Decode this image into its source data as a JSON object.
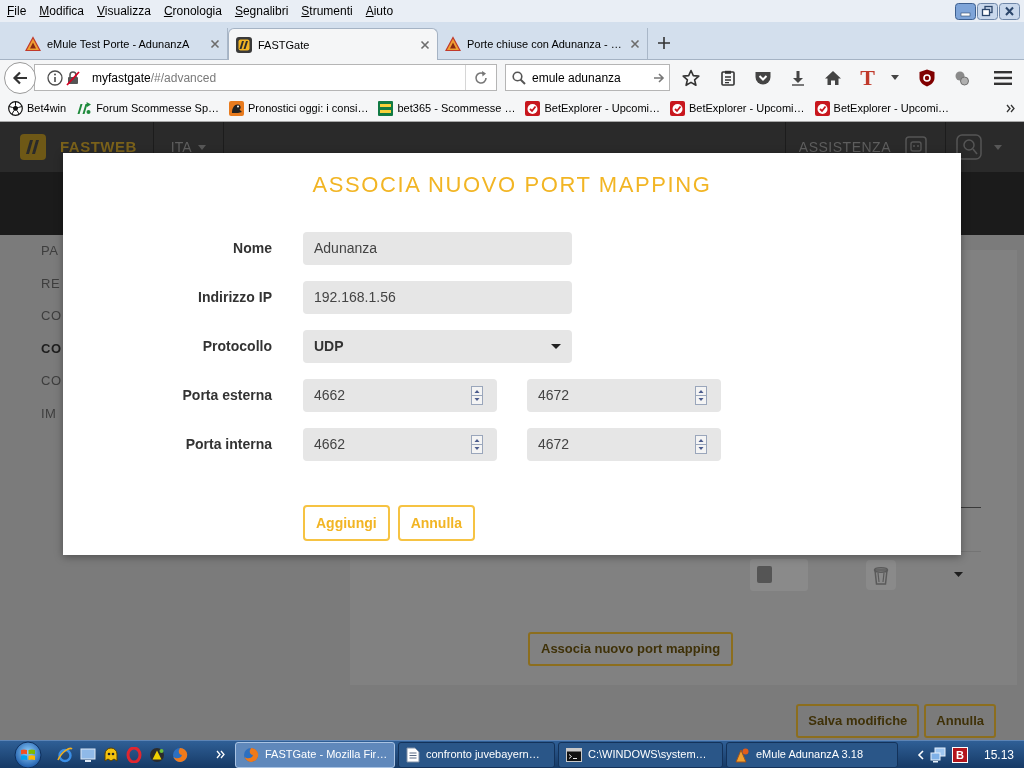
{
  "menu_bar": [
    "File",
    "Modifica",
    "Visualizza",
    "Cronologia",
    "Segnalibri",
    "Strumenti",
    "Aiuto"
  ],
  "tabs": [
    {
      "title": "eMule Test Porte - AdunanzA",
      "kind": "triangle",
      "selected": false
    },
    {
      "title": "FASTGate",
      "kind": "tile",
      "selected": true
    },
    {
      "title": "Porte chiuse con Adunanza - …",
      "kind": "triangle",
      "selected": false
    }
  ],
  "address_bar": {
    "host": "myfastgate",
    "path": "/#/advanced"
  },
  "search_field": {
    "value": "emule adunanza"
  },
  "toolbar": {
    "font_button": "T"
  },
  "bookmarks": [
    {
      "label": "Bet4win",
      "kind": "ball"
    },
    {
      "label": "Forum Scommesse Sp…",
      "kind": "letters"
    },
    {
      "label": "Pronostici oggi: i consi…",
      "kind": "silhouette"
    },
    {
      "label": "bet365 - Scommesse …",
      "kind": "tile"
    },
    {
      "label": "BetExplorer - Upcomi…",
      "kind": "seal"
    },
    {
      "label": "BetExplorer - Upcomi…",
      "kind": "seal"
    },
    {
      "label": "BetExplorer - Upcomi…",
      "kind": "seal"
    }
  ],
  "site_header": {
    "brand": "FASTWEB",
    "language": "ITA",
    "support": "ASSISTENZA"
  },
  "sidebar": [
    {
      "label": "PA",
      "selected": false
    },
    {
      "label": "RE",
      "selected": false
    },
    {
      "label": "CO",
      "selected": false
    },
    {
      "label": "CO",
      "selected": true
    },
    {
      "label": "CO",
      "selected": false
    },
    {
      "label": "IM",
      "selected": false
    }
  ],
  "mapping_row": {
    "enabled": false
  },
  "panel_button": "Associa nuovo port mapping",
  "page_buttons": [
    "Salva modifiche",
    "Annulla"
  ],
  "dialog": {
    "title": "ASSOCIA NUOVO PORT MAPPING",
    "fields": [
      {
        "kind": "text",
        "label": "Nome",
        "value": "Adunanza"
      },
      {
        "kind": "text",
        "label": "Indirizzo IP",
        "value": "192.168.1.56"
      },
      {
        "kind": "select",
        "label": "Protocollo",
        "value": "UDP"
      },
      {
        "kind": "range",
        "label": "Porta esterna",
        "values": [
          "4662",
          "4672"
        ]
      },
      {
        "kind": "range",
        "label": "Porta interna",
        "values": [
          "4662",
          "4672"
        ]
      }
    ],
    "buttons": [
      "Aggiungi",
      "Annulla"
    ]
  },
  "taskbar": {
    "windows": [
      {
        "label": "FASTGate - Mozilla Fir…",
        "kind": "browser",
        "selected": true
      },
      {
        "label": "confronto juvebayern…",
        "kind": "document",
        "selected": false
      },
      {
        "label": "C:\\WINDOWS\\system…",
        "kind": "console",
        "selected": false
      },
      {
        "label": "eMule AdunanzA 3.18",
        "kind": "app",
        "selected": false
      }
    ],
    "tray_badge": "B",
    "clock": "15.13"
  }
}
